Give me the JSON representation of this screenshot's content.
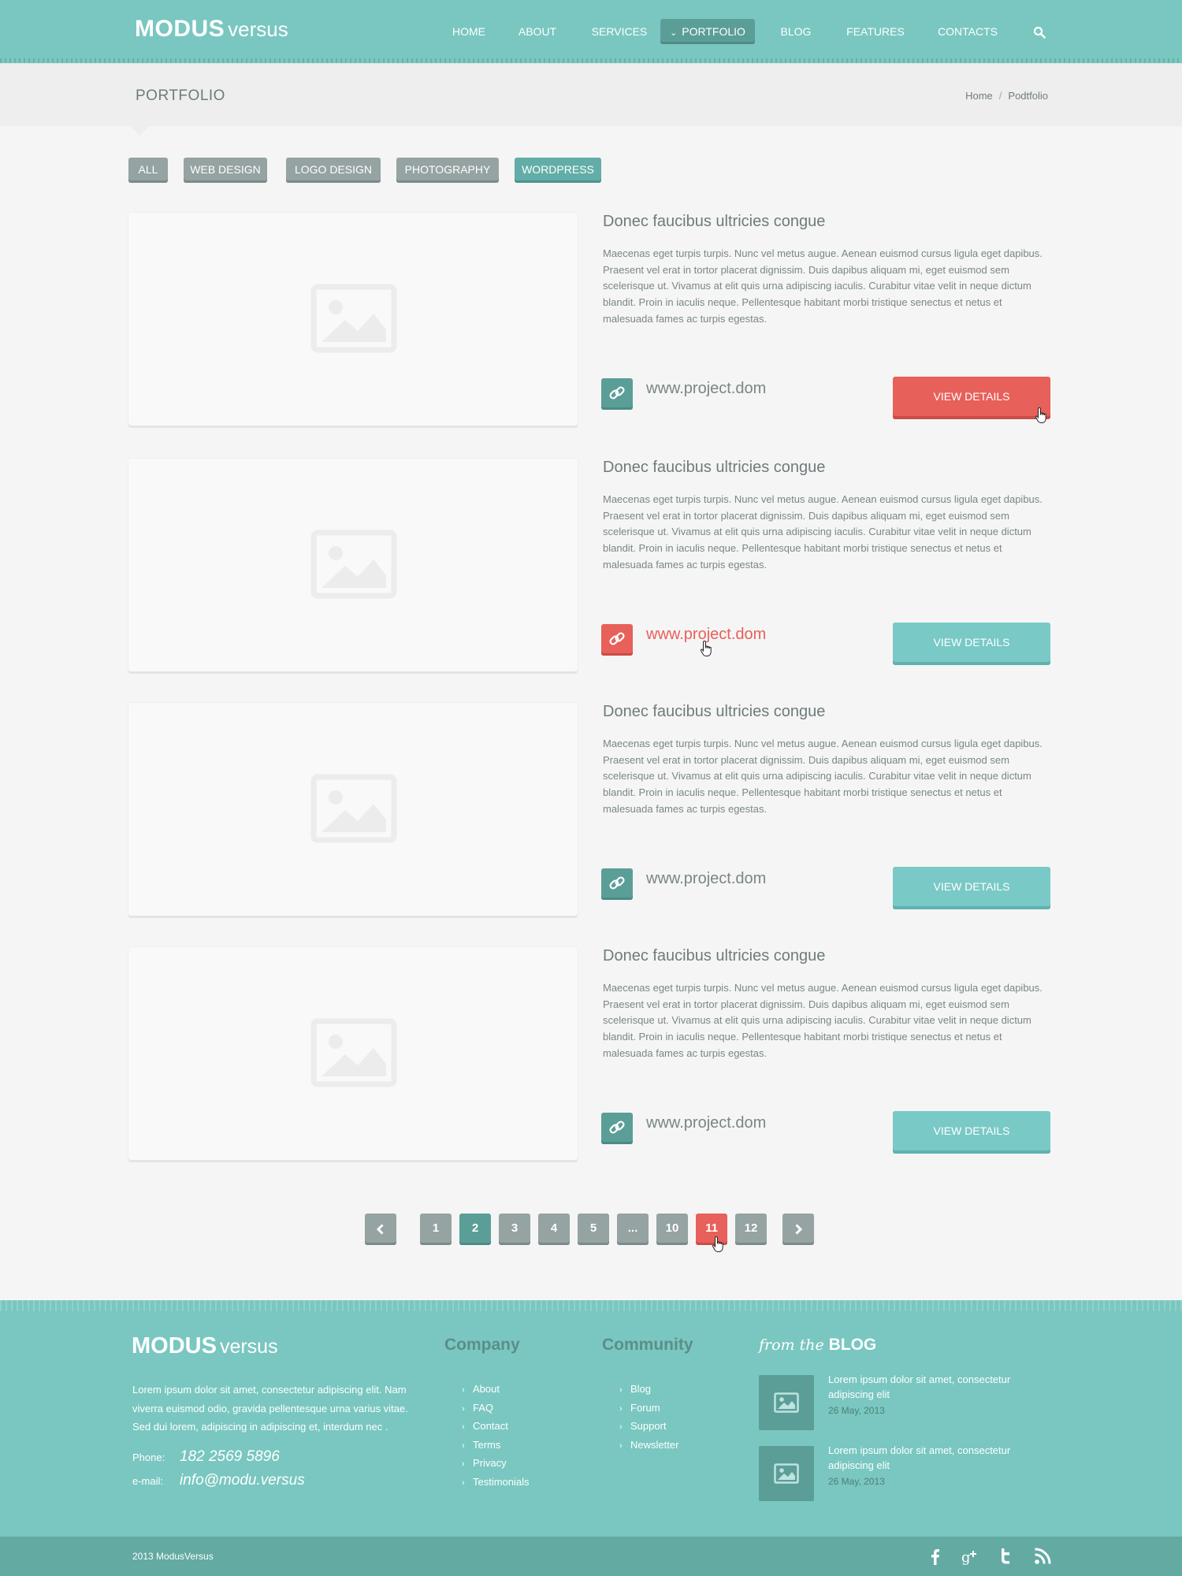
{
  "header": {
    "logo_bold": "MODUS",
    "logo_light": "versus",
    "nav": [
      "HOME",
      "ABOUT",
      "SERVICES",
      "PORTFOLIO",
      "BLOG",
      "FEATURES",
      "CONTACTS"
    ],
    "active_nav": "PORTFOLIO"
  },
  "titlebar": {
    "title": "PORTFOLIO",
    "breadcrumb": [
      "Home",
      "Podtfolio"
    ]
  },
  "filters": [
    "ALL",
    "WEB DESIGN",
    "LOGO DESIGN",
    "PHOTOGRAPHY",
    "WORDPRESS"
  ],
  "active_filter": "WORDPRESS",
  "projects": [
    {
      "title": "Donec faucibus ultricies congue",
      "text": "Maecenas eget turpis turpis. Nunc vel metus augue. Aenean euismod cursus ligula eget dapibus. Praesent vel erat in tortor placerat dignissim. Duis dapibus aliquam mi, eget euismod sem scelerisque ut. Vivamus at elit quis urna adipiscing iaculis. Curabitur vitae velit in neque dictum blandit. Proin in iaculis neque. Pellentesque habitant morbi tristique senectus et netus et malesuada fames ac turpis egestas.",
      "link": "www.project.dom",
      "button": "VIEW DETAILS"
    },
    {
      "title": "Donec faucibus ultricies congue",
      "text": "Maecenas eget turpis turpis. Nunc vel metus augue. Aenean euismod cursus ligula eget dapibus. Praesent vel erat in tortor placerat dignissim. Duis dapibus aliquam mi, eget euismod sem scelerisque ut. Vivamus at elit quis urna adipiscing iaculis. Curabitur vitae velit in neque dictum blandit. Proin in iaculis neque. Pellentesque habitant morbi tristique senectus et netus et malesuada fames ac turpis egestas.",
      "link": "www.project.dom",
      "button": "VIEW DETAILS"
    },
    {
      "title": "Donec faucibus ultricies congue",
      "text": "Maecenas eget turpis turpis. Nunc vel metus augue. Aenean euismod cursus ligula eget dapibus. Praesent vel erat in tortor placerat dignissim. Duis dapibus aliquam mi, eget euismod sem scelerisque ut. Vivamus at elit quis urna adipiscing iaculis. Curabitur vitae velit in neque dictum blandit. Proin in iaculis neque. Pellentesque habitant morbi tristique senectus et netus et malesuada fames ac turpis egestas.",
      "link": "www.project.dom",
      "button": "VIEW DETAILS"
    },
    {
      "title": "Donec faucibus ultricies congue",
      "text": "Maecenas eget turpis turpis. Nunc vel metus augue. Aenean euismod cursus ligula eget dapibus. Praesent vel erat in tortor placerat dignissim. Duis dapibus aliquam mi, eget euismod sem scelerisque ut. Vivamus at elit quis urna adipiscing iaculis. Curabitur vitae velit in neque dictum blandit. Proin in iaculis neque. Pellentesque habitant morbi tristique senectus et netus et malesuada fames ac turpis egestas.",
      "link": "www.project.dom",
      "button": "VIEW DETAILS"
    }
  ],
  "pagination": {
    "pages": [
      "1",
      "2",
      "3",
      "4",
      "5",
      "...",
      "10",
      "11",
      "12"
    ],
    "current": "2",
    "hovered": "11"
  },
  "footer": {
    "logo_bold": "MODUS",
    "logo_light": "versus",
    "about": "Lorem ipsum dolor sit amet, consectetur adipiscing elit. Nam viverra euismod odio, gravida pellentesque urna varius vitae. Sed dui lorem, adipiscing in adipiscing et, interdum nec .",
    "phone_label": "Phone:",
    "phone": "182 2569 5896",
    "email_label": "e-mail:",
    "email": "info@modu.versus",
    "company_heading": "Company",
    "company_links": [
      "About",
      "FAQ",
      "Contact",
      "Terms",
      "Privacy",
      "Testimonials"
    ],
    "community_heading": "Community",
    "community_links": [
      "Blog",
      "Forum",
      "Support",
      "Newsletter"
    ],
    "blog_heading_pre": "from the",
    "blog_heading_post": "BLOG",
    "blog_posts": [
      {
        "title": "Lorem ipsum dolor sit amet, consectetur adipiscing elit",
        "date": "26 May, 2013"
      },
      {
        "title": "Lorem ipsum dolor sit amet, consectetur adipiscing elit",
        "date": "26 May, 2013"
      }
    ],
    "copyright": "2013  ModusVersus",
    "social": [
      "facebook-icon",
      "google-plus-icon",
      "twitter-icon",
      "rss-icon"
    ]
  },
  "colors": {
    "teal": "#79c7c0",
    "dark_teal": "#5b9e98",
    "accent_red": "#e8605a",
    "gray_button": "#95a3a2"
  }
}
